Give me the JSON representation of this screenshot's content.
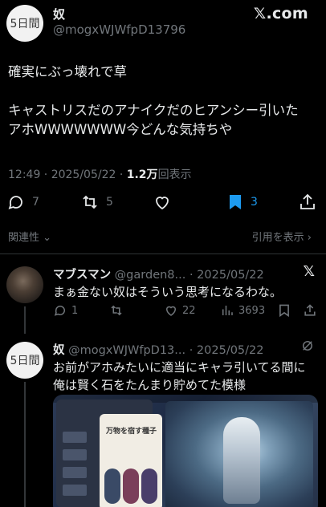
{
  "colors": {
    "background": "#000000",
    "text_primary": "#e7e9ea",
    "text_secondary": "#71767b",
    "accent_bookmark": "#1d9bf0",
    "divider": "#2f3336"
  },
  "header": {
    "avatar_text": "5日間",
    "author_name": "奴",
    "author_handle": "@mogxWJWfpD13796",
    "brand": "𝕏.com"
  },
  "tweet": {
    "line1": "確実にぶっ壊れで草",
    "line2": "キャストリスだのアナイクだのヒアンシー引いた",
    "line3": "アホWWWWWWW今どんな気持ちや"
  },
  "meta": {
    "time_date": "12:49 · 2025/05/22 · ",
    "views_count": "1.2万",
    "views_label": "回表示"
  },
  "actions": {
    "reply_icon": "reply-icon",
    "reply_count": "7",
    "retweet_icon": "retweet-icon",
    "retweet_count": "5",
    "like_icon": "like-icon",
    "bookmark_icon": "bookmark-icon",
    "bookmark_count": "3",
    "share_icon": "share-icon"
  },
  "sub_row": {
    "related": "関連性",
    "quotes": "引用を表示"
  },
  "replies": [
    {
      "avatar_icon": "user-avatar-photo",
      "name": "マブスマン",
      "handle_date": " @garden8... · 2025/05/22",
      "corner": "𝕏",
      "text": "まぁ金ない奴はそういう思考になるわな。",
      "reply_count": "1",
      "retweet_count": "",
      "like_count": "22",
      "views_count": "3693"
    },
    {
      "avatar_text": "5日間",
      "name": "奴",
      "handle_date": " @mogxWJWfpD13... · 2025/05/22",
      "text_line1": "お前がアホみたいに適当にキャラ引いてる間に",
      "text_line2": "俺は賢く石をたんまり貯めてた模様",
      "media_caption": "万物を宿す種子"
    }
  ]
}
